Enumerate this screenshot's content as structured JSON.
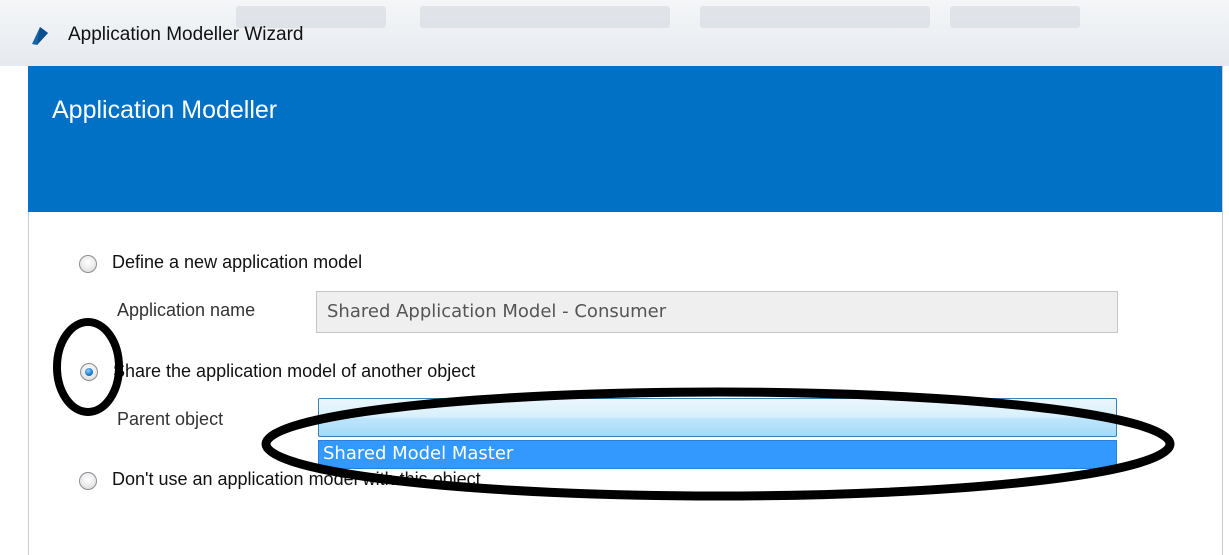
{
  "window": {
    "title": "Application Modeller Wizard"
  },
  "banner": {
    "title": "Application Modeller"
  },
  "options": {
    "define_new": {
      "label": "Define a new application model",
      "selected": false
    },
    "application_name": {
      "label": "Application name",
      "value": "Shared Application Model - Consumer"
    },
    "share_model": {
      "label": "Share the application model of another object",
      "selected": true
    },
    "parent_object": {
      "label": "Parent object",
      "value": "",
      "dropdown_items": [
        "Shared Model Master"
      ]
    },
    "no_model": {
      "label": "Don't use an application model with this object",
      "selected": false
    }
  },
  "colors": {
    "banner": "#0071c5",
    "dropdown_highlight": "#3399ff",
    "annotation": "#000000"
  }
}
